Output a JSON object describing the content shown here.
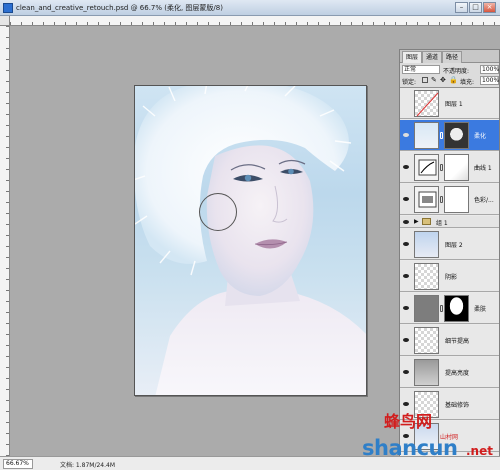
{
  "window": {
    "title": "clean_and_creative_retouch.psd @ 66.7% (柔化, 图层蒙版/8)",
    "buttons": {
      "minimize": "–",
      "maximize": "□",
      "close": "×"
    }
  },
  "status": {
    "zoom": "66.67%",
    "doc_info": "文档: 1.87M/24.4M"
  },
  "layers_panel": {
    "tabs": [
      "图层",
      "通道",
      "路径"
    ],
    "blend_mode": "正常",
    "opacity_label": "不透明度:",
    "opacity_value": "100%",
    "lock_label": "锁定:",
    "fill_label": "填充:",
    "fill_value": "100%",
    "layers": [
      {
        "name": "图层 1",
        "visible": false,
        "selected": false
      },
      {
        "name": "柔化",
        "visible": true,
        "selected": true
      },
      {
        "name": "曲线 1",
        "visible": true,
        "selected": false
      },
      {
        "name": "色彩/...",
        "visible": true,
        "selected": false
      },
      {
        "name": "组 1",
        "visible": true,
        "selected": false,
        "group": true
      },
      {
        "name": "图层 2",
        "visible": true,
        "selected": false
      },
      {
        "name": "阴影",
        "visible": true,
        "selected": false
      },
      {
        "name": "柔肤",
        "visible": true,
        "selected": false
      },
      {
        "name": "细节提高",
        "visible": true,
        "selected": false
      },
      {
        "name": "提高亮度",
        "visible": true,
        "selected": false
      },
      {
        "name": "基础修饰",
        "visible": true,
        "selected": false
      }
    ]
  },
  "watermark": {
    "top": "蜂鸟网",
    "main": "shancun",
    "sub": "山村网",
    "net": ".net"
  },
  "colors": {
    "selection": "#3b7ae0",
    "canvas_bg": "#ababab",
    "watermark_red": "#d11d1d",
    "watermark_blue": "#2f7fc8"
  }
}
